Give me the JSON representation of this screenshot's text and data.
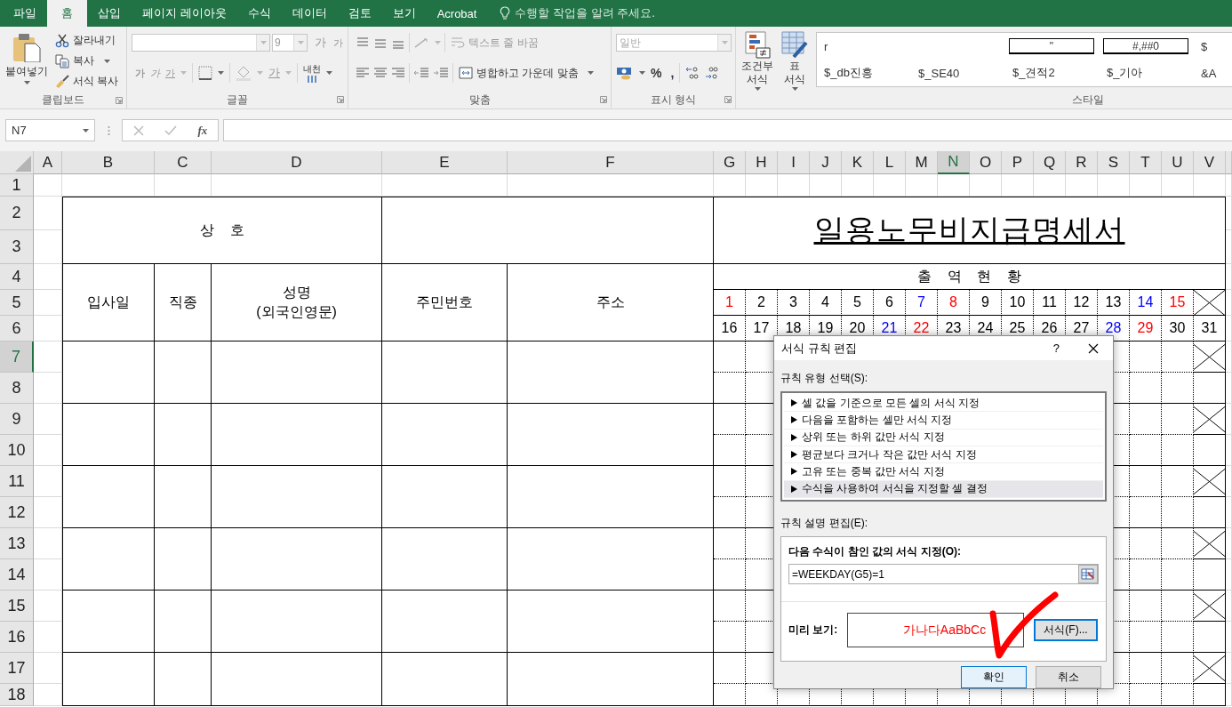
{
  "ribbon_tabs": [
    {
      "label": "파일",
      "selected": false
    },
    {
      "label": "홈",
      "selected": true
    },
    {
      "label": "삽입",
      "selected": false
    },
    {
      "label": "페이지 레이아웃",
      "selected": false
    },
    {
      "label": "수식",
      "selected": false
    },
    {
      "label": "데이터",
      "selected": false
    },
    {
      "label": "검토",
      "selected": false
    },
    {
      "label": "보기",
      "selected": false
    },
    {
      "label": "Acrobat",
      "selected": false
    }
  ],
  "tell_me": "수행할 작업을 알려 주세요.",
  "clipboard": {
    "paste": "붙여넣기",
    "cut": "잘라내기",
    "copy": "복사",
    "format_painter": "서식 복사",
    "label": "클립보드"
  },
  "font": {
    "size": "9",
    "grow": "가",
    "shrink": "가",
    "bold": "가",
    "italic": "가",
    "underline": "가",
    "font_color": "가",
    "phonetic": "내천",
    "label": "글꼴"
  },
  "alignment": {
    "wrap_text": "텍스트 줄 바꿈",
    "merge_center": "병합하고 가운데 맞춤",
    "label": "맞춤"
  },
  "number": {
    "format": "일반",
    "percent": "%",
    "comma": ",",
    "label": "표시 형식"
  },
  "styles": {
    "conditional_formatting": "조건부\n서식",
    "format_as_table": "표\n서식",
    "label": "스타일",
    "gallery": [
      [
        {
          "text": "r",
          "kind": "plain"
        },
        {
          "text": "\"",
          "kind": "boxed"
        },
        {
          "text": "#,##0",
          "kind": "boxed"
        },
        {
          "text": "$",
          "kind": "plain"
        }
      ],
      [
        {
          "text": "$_db진흥",
          "kind": "plain"
        },
        {
          "text": "$_SE40",
          "kind": "plain"
        },
        {
          "text": "$_견적2",
          "kind": "plain"
        },
        {
          "text": "$_기아",
          "kind": "plain"
        },
        {
          "text": "&A",
          "kind": "plain"
        }
      ]
    ]
  },
  "formula_bar": {
    "name_box": "N7",
    "fx": "fx"
  },
  "columns": [
    {
      "label": "A",
      "selected": false
    },
    {
      "label": "B",
      "selected": false
    },
    {
      "label": "C",
      "selected": false
    },
    {
      "label": "D",
      "selected": false
    },
    {
      "label": "E",
      "selected": false
    },
    {
      "label": "F",
      "selected": false
    },
    {
      "label": "G",
      "selected": false
    },
    {
      "label": "H",
      "selected": false
    },
    {
      "label": "I",
      "selected": false
    },
    {
      "label": "J",
      "selected": false
    },
    {
      "label": "K",
      "selected": false
    },
    {
      "label": "L",
      "selected": false
    },
    {
      "label": "M",
      "selected": false
    },
    {
      "label": "N",
      "selected": true
    },
    {
      "label": "O",
      "selected": false
    },
    {
      "label": "P",
      "selected": false
    },
    {
      "label": "Q",
      "selected": false
    },
    {
      "label": "R",
      "selected": false
    },
    {
      "label": "S",
      "selected": false
    },
    {
      "label": "T",
      "selected": false
    },
    {
      "label": "U",
      "selected": false
    },
    {
      "label": "V",
      "selected": false
    }
  ],
  "rows": [
    {
      "label": "1",
      "selected": false
    },
    {
      "label": "2",
      "selected": false
    },
    {
      "label": "3",
      "selected": false
    },
    {
      "label": "4",
      "selected": false
    },
    {
      "label": "5",
      "selected": false
    },
    {
      "label": "6",
      "selected": false
    },
    {
      "label": "7",
      "selected": true
    },
    {
      "label": "8",
      "selected": false
    },
    {
      "label": "9",
      "selected": false
    },
    {
      "label": "10",
      "selected": false
    },
    {
      "label": "11",
      "selected": false
    },
    {
      "label": "12",
      "selected": false
    },
    {
      "label": "13",
      "selected": false
    },
    {
      "label": "14",
      "selected": false
    },
    {
      "label": "15",
      "selected": false
    },
    {
      "label": "16",
      "selected": false
    },
    {
      "label": "17",
      "selected": false
    },
    {
      "label": "18",
      "selected": false
    }
  ],
  "sheet": {
    "company_label": "상    호",
    "title": "일용노무비지급명세서",
    "headers": {
      "hire_date": "입사일",
      "job": "직종",
      "name": "성명\n(외국인영문)",
      "resident_no": "주민번호",
      "address": "주소"
    },
    "attendance_label": "출    역    현    황",
    "days": [
      [
        {
          "text": "1",
          "color": "#ff0000"
        },
        {
          "text": "2",
          "color": "#000000"
        },
        {
          "text": "3",
          "color": "#000000"
        },
        {
          "text": "4",
          "color": "#000000"
        },
        {
          "text": "5",
          "color": "#000000"
        },
        {
          "text": "6",
          "color": "#000000"
        },
        {
          "text": "7",
          "color": "#0000ff"
        },
        {
          "text": "8",
          "color": "#ff0000"
        },
        {
          "text": "9",
          "color": "#000000"
        },
        {
          "text": "10",
          "color": "#000000"
        },
        {
          "text": "11",
          "color": "#000000"
        },
        {
          "text": "12",
          "color": "#000000"
        },
        {
          "text": "13",
          "color": "#000000"
        },
        {
          "text": "14",
          "color": "#0000ff"
        },
        {
          "text": "15",
          "color": "#ff0000"
        }
      ],
      [
        {
          "text": "16",
          "color": "#000000"
        },
        {
          "text": "17",
          "color": "#000000"
        },
        {
          "text": "18",
          "color": "#000000"
        },
        {
          "text": "19",
          "color": "#000000"
        },
        {
          "text": "20",
          "color": "#000000"
        },
        {
          "text": "21",
          "color": "#0000ff"
        },
        {
          "text": "22",
          "color": "#ff0000"
        },
        {
          "text": "23",
          "color": "#000000"
        },
        {
          "text": "24",
          "color": "#000000"
        },
        {
          "text": "25",
          "color": "#000000"
        },
        {
          "text": "26",
          "color": "#000000"
        },
        {
          "text": "27",
          "color": "#000000"
        },
        {
          "text": "28",
          "color": "#0000ff"
        },
        {
          "text": "29",
          "color": "#ff0000"
        },
        {
          "text": "30",
          "color": "#000000"
        },
        {
          "text": "31",
          "color": "#000000"
        }
      ]
    ]
  },
  "dialog": {
    "title": "서식 규칙 편집",
    "help": "?",
    "rule_type_label": "규칙 유형 선택(S):",
    "rule_types": [
      {
        "text": "셀 값을 기준으로 모든 셀의 서식 지정",
        "selected": false
      },
      {
        "text": "다음을 포함하는 셀만 서식 지정",
        "selected": false
      },
      {
        "text": "상위 또는 하위 값만 서식 지정",
        "selected": false
      },
      {
        "text": "평균보다 크거나 작은 값만 서식 지정",
        "selected": false
      },
      {
        "text": "고유 또는 중복 값만 서식 지정",
        "selected": false
      },
      {
        "text": "수식을 사용하여 서식을 지정할 셀 결정",
        "selected": true
      }
    ],
    "description_label": "규칙 설명 편집(E):",
    "formula_label": "다음 수식이 참인 값의 서식 지정(O):",
    "formula": "=WEEKDAY(G5)=1",
    "preview_label": "미리 보기:",
    "preview_text": "가나다AaBbCc",
    "format_button": "서식(F)...",
    "ok_button": "확인",
    "cancel_button": "취소"
  }
}
